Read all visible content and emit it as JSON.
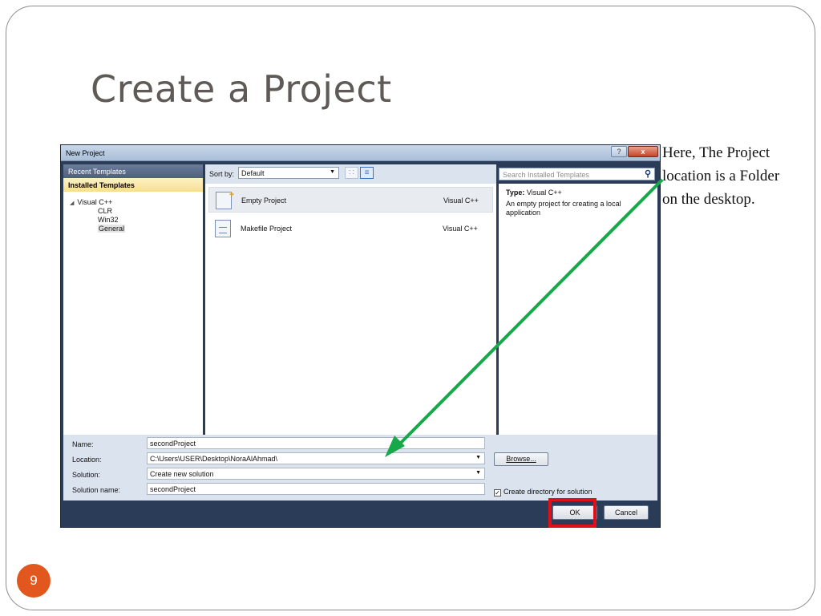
{
  "slide": {
    "title": "Create a Project",
    "page_number": "9",
    "note_lines": [
      "Here, The Project",
      "location is a Folder",
      "on the desktop."
    ]
  },
  "dialog": {
    "title": "New Project",
    "help_label": "?",
    "close_label": "x",
    "left_pane": {
      "recent_templates": "Recent Templates",
      "installed_templates": "Installed Templates",
      "tree": {
        "root": "Visual C++",
        "children": [
          "CLR",
          "Win32",
          "General"
        ],
        "selected": "General"
      }
    },
    "sort": {
      "label": "Sort by:",
      "value": "Default"
    },
    "templates": [
      {
        "name": "Empty Project",
        "language": "Visual C++",
        "selected": true
      },
      {
        "name": "Makefile Project",
        "language": "Visual C++",
        "selected": false
      }
    ],
    "search": {
      "placeholder": "Search Installed Templates"
    },
    "info": {
      "type_label": "Type:",
      "type_value": "Visual C++",
      "description": "An empty project for creating a local application"
    },
    "form": {
      "name_label": "Name:",
      "name_value": "secondProject",
      "location_label": "Location:",
      "location_value": "C:\\Users\\USER\\Desktop\\NoraAlAhmad\\",
      "solution_label": "Solution:",
      "solution_value": "Create new solution",
      "solution_name_label": "Solution name:",
      "solution_name_value": "secondProject",
      "browse_label": "Browse...",
      "create_dir_label": "Create directory for solution",
      "create_dir_checked": true
    },
    "buttons": {
      "ok": "OK",
      "cancel": "Cancel"
    }
  },
  "colors": {
    "accent_badge": "#e2571e",
    "annotation_arrow": "#17a84a",
    "ok_highlight": "#e0101a"
  }
}
